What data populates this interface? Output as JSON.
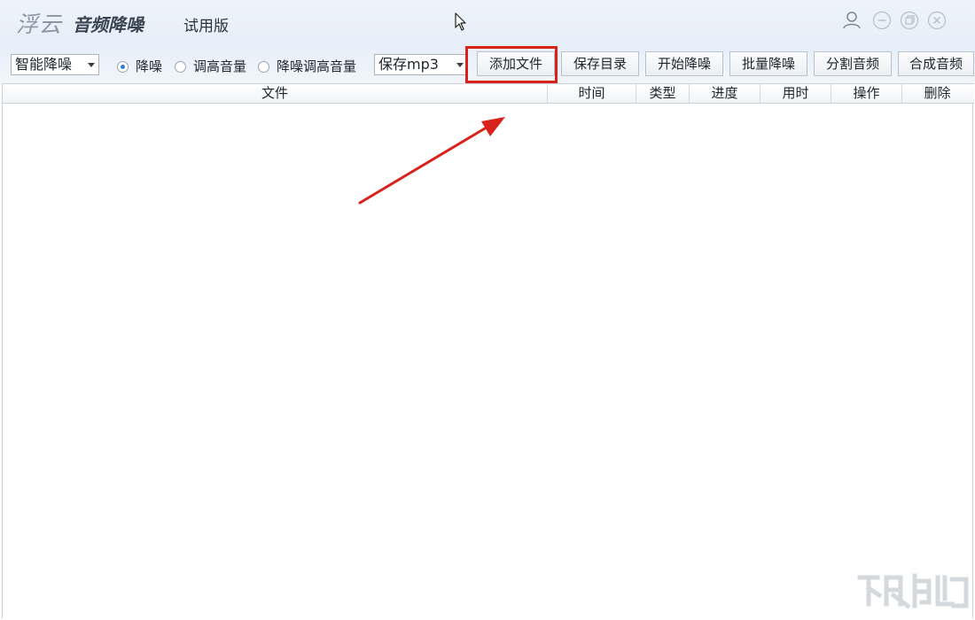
{
  "titlebar": {
    "logo_text": "浮云",
    "app_name": "音频降噪",
    "edition": "试用版",
    "controls": {
      "user": "user-icon",
      "minimize": "minimize-icon",
      "restore": "restore-icon",
      "close": "close-icon"
    }
  },
  "toolbar": {
    "mode_select": {
      "value": "智能降噪"
    },
    "radios": [
      {
        "label": "降噪",
        "checked": true
      },
      {
        "label": "调高音量",
        "checked": false
      },
      {
        "label": "降噪调高音量",
        "checked": false
      }
    ],
    "format_select": {
      "value": "保存mp3"
    },
    "buttons": {
      "add_file": "添加文件",
      "save_dir": "保存目录",
      "start": "开始降噪",
      "batch": "批量降噪",
      "split": "分割音频",
      "merge": "合成音频"
    }
  },
  "table": {
    "columns": [
      "文件",
      "时间",
      "类型",
      "进度",
      "用时",
      "操作",
      "删除"
    ],
    "rows": []
  },
  "annotation": {
    "highlight_color": "#d9221c",
    "arrow_color": "#d9221c"
  },
  "colors": {
    "radio_accent": "#2f7fd6"
  }
}
